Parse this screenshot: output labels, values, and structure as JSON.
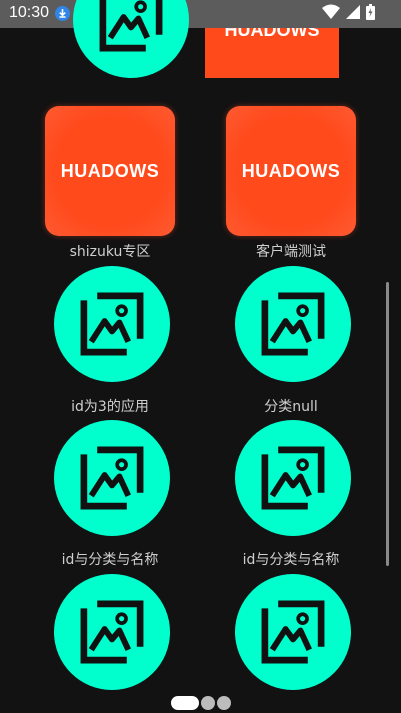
{
  "status_bar": {
    "time": "10:30"
  },
  "grid": {
    "partial_top_right_text": "HUADOWS",
    "items": [
      {
        "label": "shizuku专区",
        "icon_text": "HUADOWS"
      },
      {
        "label": "客户端测试",
        "icon_text": "HUADOWS"
      },
      {
        "label": "id为3的应用"
      },
      {
        "label": "分类null"
      },
      {
        "label": "id与分类与名称"
      },
      {
        "label": "id与分类与名称"
      },
      {
        "label": ""
      },
      {
        "label": ""
      }
    ]
  },
  "pager": {
    "pages": 3,
    "active": 0
  },
  "colors": {
    "accent": "#00ffcc",
    "tile": "#ff4a1c",
    "background": "#121212"
  }
}
